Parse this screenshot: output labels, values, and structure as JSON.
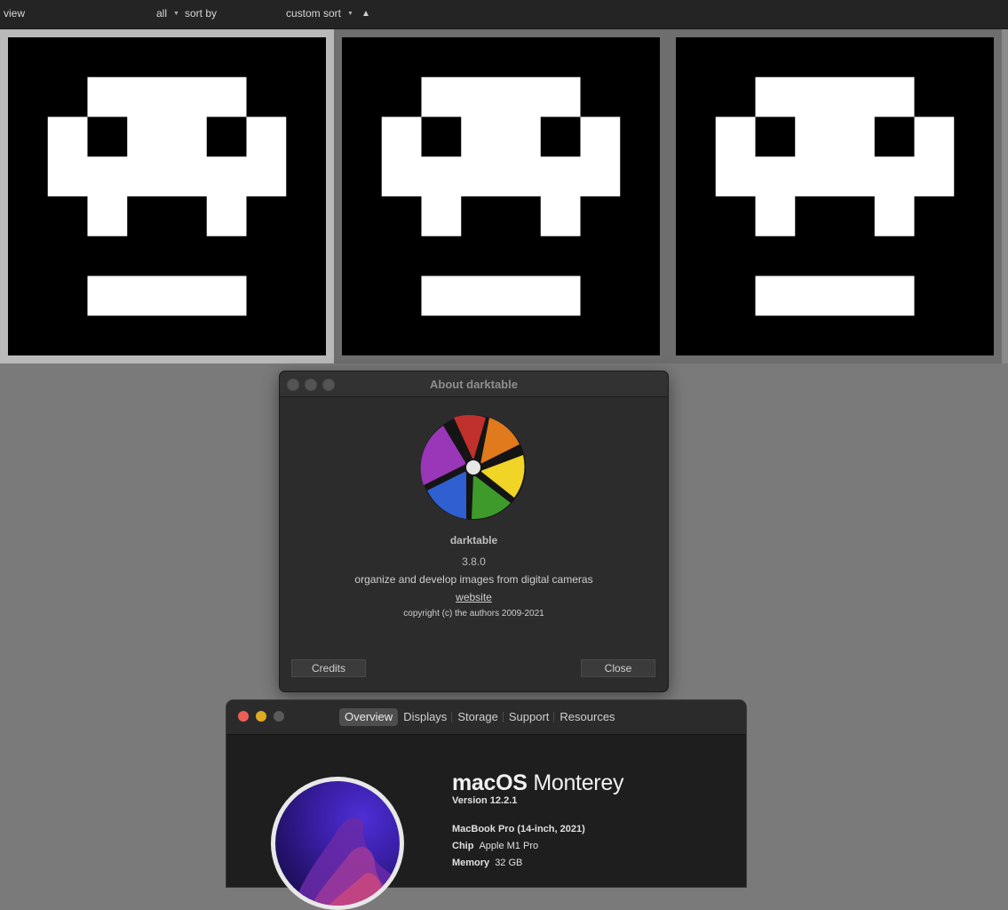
{
  "filterbar": {
    "view_label": "view",
    "filter_value": "all",
    "sort_label": "sort by",
    "sort_value": "custom sort"
  },
  "thumbnails": {
    "count": 3,
    "selected_index": 0
  },
  "about_dialog": {
    "title": "About darktable",
    "app_name": "darktable",
    "version": "3.8.0",
    "description": "organize and develop images from digital cameras",
    "website_label": "website",
    "copyright": "copyright (c) the authors 2009-2021",
    "credits_label": "Credits",
    "close_label": "Close"
  },
  "about_mac": {
    "tabs": [
      "Overview",
      "Displays",
      "Storage",
      "Support",
      "Resources"
    ],
    "active_tab": "Overview",
    "os_brand": "macOS",
    "os_release": "Monterey",
    "version": "Version 12.2.1",
    "model": "MacBook Pro (14-inch, 2021)",
    "chip_label": "Chip",
    "chip_value": "Apple M1 Pro",
    "memory_label": "Memory",
    "memory_value": "32 GB"
  },
  "colors": {
    "dt_petal_red": "#c0302c",
    "dt_petal_orange": "#e07a1c",
    "dt_petal_yellow": "#f0d426",
    "dt_petal_green": "#3e9a2a",
    "dt_petal_blue": "#2f5fd0",
    "dt_petal_purple": "#9a36b8",
    "mac_close": "#ec5f57",
    "mac_minimize": "#e0a823"
  }
}
